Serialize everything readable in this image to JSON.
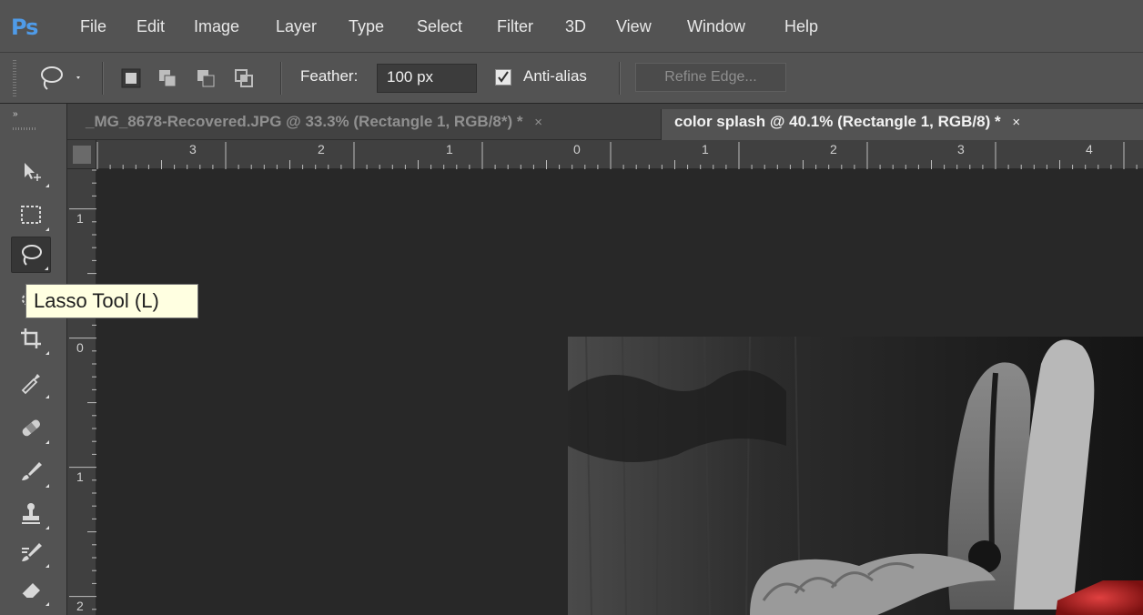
{
  "app": {
    "logo": "Ps"
  },
  "menu": [
    "File",
    "Edit",
    "Image",
    "Layer",
    "Type",
    "Select",
    "Filter",
    "3D",
    "View",
    "Window",
    "Help"
  ],
  "options": {
    "feather_label": "Feather:",
    "feather_value": "100 px",
    "antialias_label": "Anti-alias",
    "antialias_checked": true,
    "refine_edge_label": "Refine Edge..."
  },
  "tabs": [
    {
      "title": "_MG_8678-Recovered.JPG @ 33.3% (Rectangle 1, RGB/8*) *",
      "close": "×",
      "active": false
    },
    {
      "title": "color splash @ 40.1% (Rectangle 1, RGB/8) *",
      "close": "×",
      "active": true
    }
  ],
  "ruler": {
    "horizontal": [
      "3",
      "2",
      "1",
      "0",
      "1",
      "2",
      "3",
      "4"
    ],
    "vertical": [
      "1",
      "0",
      "1",
      "2"
    ]
  },
  "toolbox": {
    "collapse_glyph": "»",
    "tools": [
      {
        "name": "move-tool",
        "icon": "move-icon",
        "active": false
      },
      {
        "name": "marquee-tool",
        "icon": "rect-marquee-icon",
        "active": false
      },
      {
        "name": "lasso-tool",
        "icon": "lasso-icon",
        "active": true
      },
      {
        "name": "quick-selection-tool",
        "icon": "quick-selection-icon",
        "active": false
      },
      {
        "name": "crop-tool",
        "icon": "crop-icon",
        "active": false
      },
      {
        "name": "eyedropper-tool",
        "icon": "eyedropper-icon",
        "active": false
      },
      {
        "name": "healing-brush-tool",
        "icon": "bandage-icon",
        "active": false
      },
      {
        "name": "brush-tool",
        "icon": "brush-icon",
        "active": false
      },
      {
        "name": "clone-stamp-tool",
        "icon": "stamp-icon",
        "active": false
      },
      {
        "name": "history-brush-tool",
        "icon": "history-brush-icon",
        "active": false
      },
      {
        "name": "eraser-tool",
        "icon": "eraser-icon",
        "active": false
      }
    ]
  },
  "tooltip": {
    "text": "Lasso Tool (L)"
  },
  "colors": {
    "chrome": "#535353",
    "canvas_bg": "#282828",
    "logo_blue": "#4f9be8",
    "tooltip_bg": "#ffffe1"
  }
}
